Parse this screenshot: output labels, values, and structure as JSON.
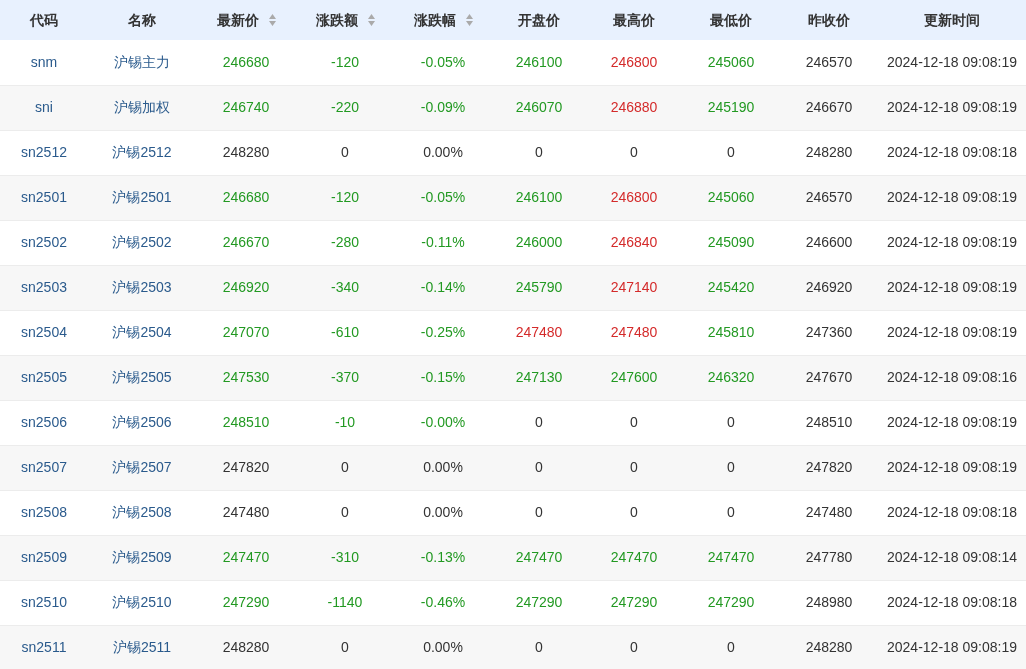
{
  "columns": [
    {
      "label": "代码",
      "sortable": false
    },
    {
      "label": "名称",
      "sortable": false
    },
    {
      "label": "最新价",
      "sortable": true
    },
    {
      "label": "涨跌额",
      "sortable": true
    },
    {
      "label": "涨跌幅",
      "sortable": true
    },
    {
      "label": "开盘价",
      "sortable": false
    },
    {
      "label": "最高价",
      "sortable": false
    },
    {
      "label": "最低价",
      "sortable": false
    },
    {
      "label": "昨收价",
      "sortable": false
    },
    {
      "label": "更新时间",
      "sortable": false
    }
  ],
  "rows": [
    {
      "code": "snm",
      "name": "沪锡主力",
      "cells": [
        {
          "text": "246680",
          "color": "#229922"
        },
        {
          "text": "-120",
          "color": "#229922"
        },
        {
          "text": "-0.05%",
          "color": "#229922"
        },
        {
          "text": "246100",
          "color": "#229922"
        },
        {
          "text": "246800",
          "color": "#d42a2a"
        },
        {
          "text": "245060",
          "color": "#229922"
        },
        {
          "text": "246570",
          "color": "#333333"
        },
        {
          "text": "2024-12-18 09:08:19",
          "color": "#333333"
        }
      ]
    },
    {
      "code": "sni",
      "name": "沪锡加权",
      "cells": [
        {
          "text": "246740",
          "color": "#229922"
        },
        {
          "text": "-220",
          "color": "#229922"
        },
        {
          "text": "-0.09%",
          "color": "#229922"
        },
        {
          "text": "246070",
          "color": "#229922"
        },
        {
          "text": "246880",
          "color": "#d42a2a"
        },
        {
          "text": "245190",
          "color": "#229922"
        },
        {
          "text": "246670",
          "color": "#333333"
        },
        {
          "text": "2024-12-18 09:08:19",
          "color": "#333333"
        }
      ]
    },
    {
      "code": "sn2512",
      "name": "沪锡2512",
      "cells": [
        {
          "text": "248280",
          "color": "#333333"
        },
        {
          "text": "0",
          "color": "#333333"
        },
        {
          "text": "0.00%",
          "color": "#333333"
        },
        {
          "text": "0",
          "color": "#333333"
        },
        {
          "text": "0",
          "color": "#333333"
        },
        {
          "text": "0",
          "color": "#333333"
        },
        {
          "text": "248280",
          "color": "#333333"
        },
        {
          "text": "2024-12-18 09:08:18",
          "color": "#333333"
        }
      ]
    },
    {
      "code": "sn2501",
      "name": "沪锡2501",
      "cells": [
        {
          "text": "246680",
          "color": "#229922"
        },
        {
          "text": "-120",
          "color": "#229922"
        },
        {
          "text": "-0.05%",
          "color": "#229922"
        },
        {
          "text": "246100",
          "color": "#229922"
        },
        {
          "text": "246800",
          "color": "#d42a2a"
        },
        {
          "text": "245060",
          "color": "#229922"
        },
        {
          "text": "246570",
          "color": "#333333"
        },
        {
          "text": "2024-12-18 09:08:19",
          "color": "#333333"
        }
      ]
    },
    {
      "code": "sn2502",
      "name": "沪锡2502",
      "cells": [
        {
          "text": "246670",
          "color": "#229922"
        },
        {
          "text": "-280",
          "color": "#229922"
        },
        {
          "text": "-0.11%",
          "color": "#229922"
        },
        {
          "text": "246000",
          "color": "#229922"
        },
        {
          "text": "246840",
          "color": "#d42a2a"
        },
        {
          "text": "245090",
          "color": "#229922"
        },
        {
          "text": "246600",
          "color": "#333333"
        },
        {
          "text": "2024-12-18 09:08:19",
          "color": "#333333"
        }
      ]
    },
    {
      "code": "sn2503",
      "name": "沪锡2503",
      "cells": [
        {
          "text": "246920",
          "color": "#229922"
        },
        {
          "text": "-340",
          "color": "#229922"
        },
        {
          "text": "-0.14%",
          "color": "#229922"
        },
        {
          "text": "245790",
          "color": "#229922"
        },
        {
          "text": "247140",
          "color": "#d42a2a"
        },
        {
          "text": "245420",
          "color": "#229922"
        },
        {
          "text": "246920",
          "color": "#333333"
        },
        {
          "text": "2024-12-18 09:08:19",
          "color": "#333333"
        }
      ]
    },
    {
      "code": "sn2504",
      "name": "沪锡2504",
      "cells": [
        {
          "text": "247070",
          "color": "#229922"
        },
        {
          "text": "-610",
          "color": "#229922"
        },
        {
          "text": "-0.25%",
          "color": "#229922"
        },
        {
          "text": "247480",
          "color": "#d42a2a"
        },
        {
          "text": "247480",
          "color": "#d42a2a"
        },
        {
          "text": "245810",
          "color": "#229922"
        },
        {
          "text": "247360",
          "color": "#333333"
        },
        {
          "text": "2024-12-18 09:08:19",
          "color": "#333333"
        }
      ]
    },
    {
      "code": "sn2505",
      "name": "沪锡2505",
      "cells": [
        {
          "text": "247530",
          "color": "#229922"
        },
        {
          "text": "-370",
          "color": "#229922"
        },
        {
          "text": "-0.15%",
          "color": "#229922"
        },
        {
          "text": "247130",
          "color": "#229922"
        },
        {
          "text": "247600",
          "color": "#229922"
        },
        {
          "text": "246320",
          "color": "#229922"
        },
        {
          "text": "247670",
          "color": "#333333"
        },
        {
          "text": "2024-12-18 09:08:16",
          "color": "#333333"
        }
      ]
    },
    {
      "code": "sn2506",
      "name": "沪锡2506",
      "cells": [
        {
          "text": "248510",
          "color": "#229922"
        },
        {
          "text": "-10",
          "color": "#229922"
        },
        {
          "text": "-0.00%",
          "color": "#229922"
        },
        {
          "text": "0",
          "color": "#333333"
        },
        {
          "text": "0",
          "color": "#333333"
        },
        {
          "text": "0",
          "color": "#333333"
        },
        {
          "text": "248510",
          "color": "#333333"
        },
        {
          "text": "2024-12-18 09:08:19",
          "color": "#333333"
        }
      ]
    },
    {
      "code": "sn2507",
      "name": "沪锡2507",
      "cells": [
        {
          "text": "247820",
          "color": "#333333"
        },
        {
          "text": "0",
          "color": "#333333"
        },
        {
          "text": "0.00%",
          "color": "#333333"
        },
        {
          "text": "0",
          "color": "#333333"
        },
        {
          "text": "0",
          "color": "#333333"
        },
        {
          "text": "0",
          "color": "#333333"
        },
        {
          "text": "247820",
          "color": "#333333"
        },
        {
          "text": "2024-12-18 09:08:19",
          "color": "#333333"
        }
      ]
    },
    {
      "code": "sn2508",
      "name": "沪锡2508",
      "cells": [
        {
          "text": "247480",
          "color": "#333333"
        },
        {
          "text": "0",
          "color": "#333333"
        },
        {
          "text": "0.00%",
          "color": "#333333"
        },
        {
          "text": "0",
          "color": "#333333"
        },
        {
          "text": "0",
          "color": "#333333"
        },
        {
          "text": "0",
          "color": "#333333"
        },
        {
          "text": "247480",
          "color": "#333333"
        },
        {
          "text": "2024-12-18 09:08:18",
          "color": "#333333"
        }
      ]
    },
    {
      "code": "sn2509",
      "name": "沪锡2509",
      "cells": [
        {
          "text": "247470",
          "color": "#229922"
        },
        {
          "text": "-310",
          "color": "#229922"
        },
        {
          "text": "-0.13%",
          "color": "#229922"
        },
        {
          "text": "247470",
          "color": "#229922"
        },
        {
          "text": "247470",
          "color": "#229922"
        },
        {
          "text": "247470",
          "color": "#229922"
        },
        {
          "text": "247780",
          "color": "#333333"
        },
        {
          "text": "2024-12-18 09:08:14",
          "color": "#333333"
        }
      ]
    },
    {
      "code": "sn2510",
      "name": "沪锡2510",
      "cells": [
        {
          "text": "247290",
          "color": "#229922"
        },
        {
          "text": "-1140",
          "color": "#229922"
        },
        {
          "text": "-0.46%",
          "color": "#229922"
        },
        {
          "text": "247290",
          "color": "#229922"
        },
        {
          "text": "247290",
          "color": "#229922"
        },
        {
          "text": "247290",
          "color": "#229922"
        },
        {
          "text": "248980",
          "color": "#333333"
        },
        {
          "text": "2024-12-18 09:08:18",
          "color": "#333333"
        }
      ]
    },
    {
      "code": "sn2511",
      "name": "沪锡2511",
      "cells": [
        {
          "text": "248280",
          "color": "#333333"
        },
        {
          "text": "0",
          "color": "#333333"
        },
        {
          "text": "0.00%",
          "color": "#333333"
        },
        {
          "text": "0",
          "color": "#333333"
        },
        {
          "text": "0",
          "color": "#333333"
        },
        {
          "text": "0",
          "color": "#333333"
        },
        {
          "text": "248280",
          "color": "#333333"
        },
        {
          "text": "2024-12-18 09:08:19",
          "color": "#333333"
        }
      ]
    }
  ]
}
